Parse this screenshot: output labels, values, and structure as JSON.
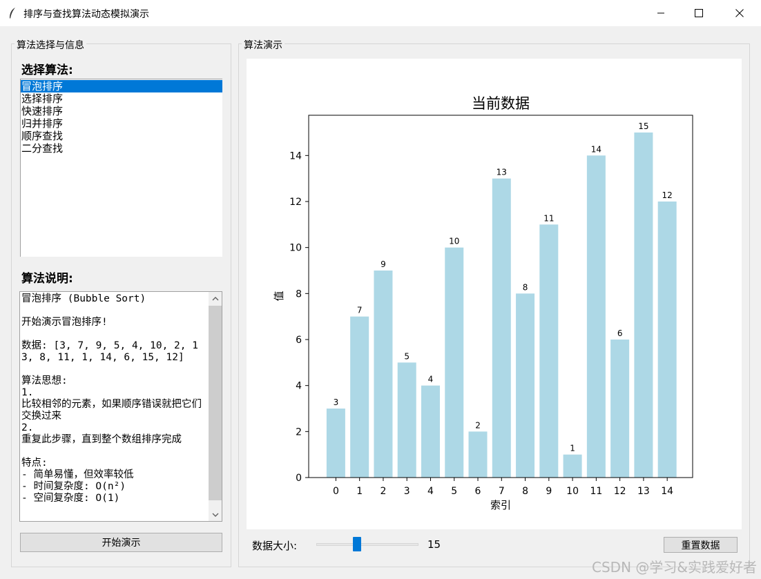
{
  "window": {
    "title": "排序与查找算法动态模拟演示"
  },
  "left_panel": {
    "group_title": "算法选择与信息",
    "select_heading": "选择算法:",
    "algorithms": [
      "冒泡排序",
      "选择排序",
      "快速排序",
      "归并排序",
      "顺序查找",
      "二分查找"
    ],
    "selected_index": 0,
    "info_heading": "算法说明:",
    "info_text": "冒泡排序 (Bubble Sort)\n\n开始演示冒泡排序!\n\n数据: [3, 7, 9, 5, 4, 10, 2, 13, 8, 11, 1, 14, 6, 15, 12]\n\n算法思想:\n1.\n比较相邻的元素，如果顺序错误就把它们交换过来\n2.\n重复此步骤，直到整个数组排序完成\n\n特点:\n- 简单易懂，但效率较低\n- 时间复杂度: O(n²)\n- 空间复杂度: O(1)",
    "start_button": "开始演示"
  },
  "right_panel": {
    "group_title": "算法演示",
    "size_label": "数据大小:",
    "size_value": "15",
    "size_min": 5,
    "size_max": 50,
    "reset_button": "重置数据"
  },
  "chart_data": {
    "type": "bar",
    "title": "当前数据",
    "xlabel": "索引",
    "ylabel": "值",
    "categories": [
      "0",
      "1",
      "2",
      "3",
      "4",
      "5",
      "6",
      "7",
      "8",
      "9",
      "10",
      "11",
      "12",
      "13",
      "14"
    ],
    "values": [
      3,
      7,
      9,
      5,
      4,
      10,
      2,
      13,
      8,
      11,
      1,
      14,
      6,
      15,
      12
    ],
    "ylim": [
      0,
      15.75
    ],
    "yticks": [
      0,
      2,
      4,
      6,
      8,
      10,
      12,
      14
    ],
    "bar_color": "#add8e6",
    "grid": false
  },
  "watermark": "CSDN @学习&实践爱好者",
  "colors": {
    "selection": "#0078d7",
    "window_bg": "#f0f0f0"
  }
}
